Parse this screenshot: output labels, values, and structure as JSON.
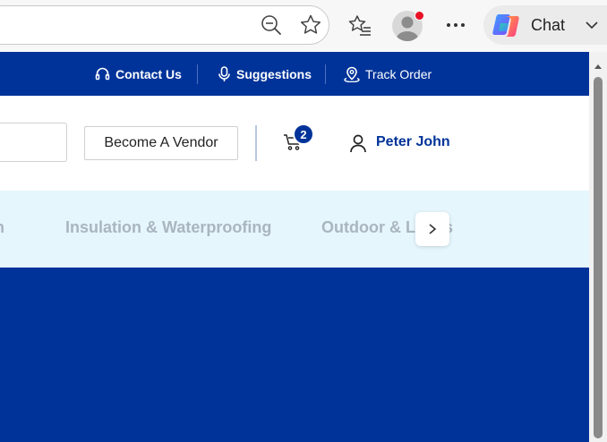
{
  "browser": {
    "copilot_label": "Chat",
    "icons": {
      "zoom": "zoom-out-icon",
      "favorite": "star-icon",
      "favorites": "favorites-list-icon",
      "profile": "profile-avatar",
      "more": "more-icon",
      "copilot": "copilot-icon",
      "expand": "chevron-down-icon"
    },
    "notification_color": "#e81123"
  },
  "topbar": {
    "links": [
      {
        "label": "Contact Us",
        "icon": "headset-icon"
      },
      {
        "label": "Suggestions",
        "icon": "microphone-icon"
      },
      {
        "label": "Track Order",
        "icon": "location-pin-icon"
      }
    ]
  },
  "header": {
    "vendor_button": "Become A Vendor",
    "cart_count": "2",
    "user_name": "Peter John"
  },
  "categories": {
    "items": [
      "on",
      "Insulation & Waterproofing",
      "Outdoor & Lands"
    ]
  },
  "colors": {
    "brand": "#003399",
    "category_bg": "#e6f6fd",
    "category_text": "#a9b6c0"
  }
}
